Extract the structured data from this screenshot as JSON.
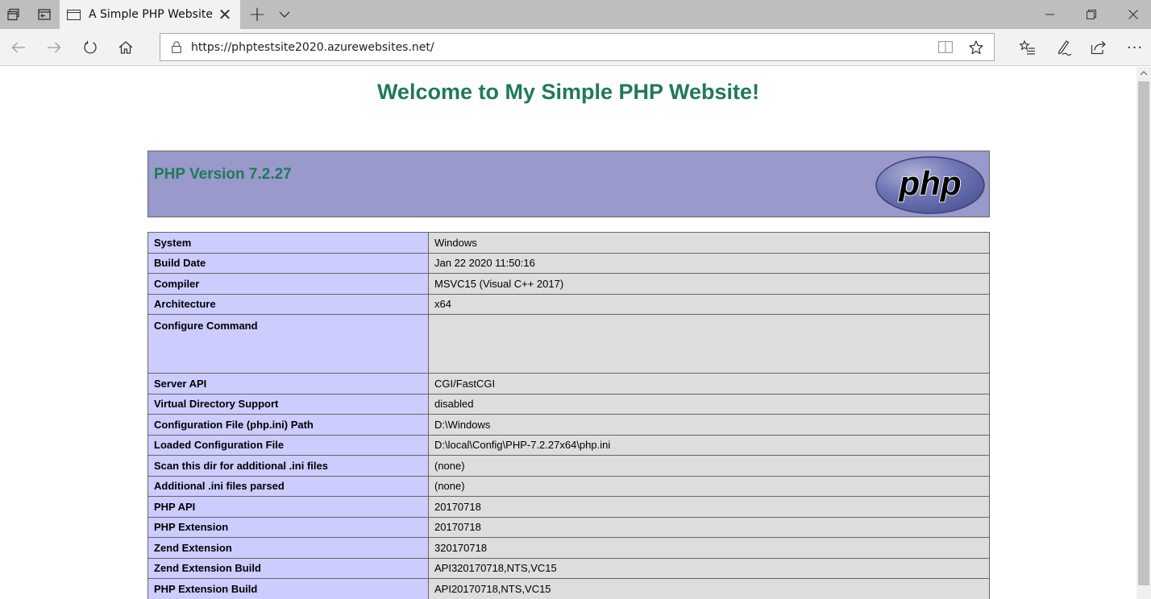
{
  "browser": {
    "tab": {
      "title": "A Simple PHP Website",
      "icon": "page-icon"
    },
    "address": {
      "url": "https://phptestsite2020.azurewebsites.net/"
    },
    "icons": {
      "tab_set_aside": "tabs-aside-icon",
      "tab_preview": "tab-preview-icon",
      "new_tab": "plus-icon",
      "tab_list": "chevron-down-icon",
      "back": "back-arrow-icon",
      "forward": "forward-arrow-icon",
      "refresh": "refresh-icon",
      "home": "home-icon",
      "lock": "lock-icon",
      "reading_view": "reading-view-icon",
      "favorite": "star-icon",
      "favorites_hub": "favorites-list-icon",
      "notes": "pen-icon",
      "share": "share-icon",
      "more": "more-icon"
    },
    "window": {
      "minimize": "minimize-icon",
      "restore": "restore-icon",
      "close": "close-icon"
    }
  },
  "page": {
    "heading": "Welcome to My Simple PHP Website!",
    "php_version": "PHP Version 7.2.27",
    "logo_text": "php",
    "colors": {
      "heading": "#1f7a57",
      "header_bg": "#9999cc",
      "key_bg": "#ccccff",
      "value_bg": "#dddddd"
    },
    "rows": [
      {
        "key": "System",
        "value": "Windows"
      },
      {
        "key": "Build Date",
        "value": "Jan 22 2020 11:50:16"
      },
      {
        "key": "Compiler",
        "value": "MSVC15 (Visual C++ 2017)"
      },
      {
        "key": "Architecture",
        "value": "x64"
      },
      {
        "key": "Configure Command",
        "value": ""
      },
      {
        "key": "Server API",
        "value": "CGI/FastCGI"
      },
      {
        "key": "Virtual Directory Support",
        "value": "disabled"
      },
      {
        "key": "Configuration File (php.ini) Path",
        "value": "D:\\Windows"
      },
      {
        "key": "Loaded Configuration File",
        "value": "D:\\local\\Config\\PHP-7.2.27x64\\php.ini"
      },
      {
        "key": "Scan this dir for additional .ini files",
        "value": "(none)"
      },
      {
        "key": "Additional .ini files parsed",
        "value": "(none)"
      },
      {
        "key": "PHP API",
        "value": "20170718"
      },
      {
        "key": "PHP Extension",
        "value": "20170718"
      },
      {
        "key": "Zend Extension",
        "value": "320170718"
      },
      {
        "key": "Zend Extension Build",
        "value": "API320170718,NTS,VC15"
      },
      {
        "key": "PHP Extension Build",
        "value": "API20170718,NTS,VC15"
      }
    ]
  }
}
